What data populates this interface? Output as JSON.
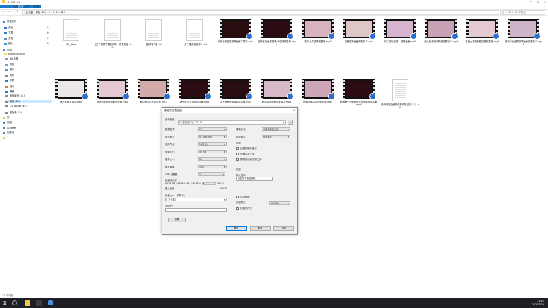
{
  "explorer": {
    "title": "11111111",
    "ribbon_tabs": [
      "文件",
      "主页",
      "共享",
      "查看"
    ],
    "address": "› 此电脑 › 新加 (D:) › 1 › 11111111",
    "search_placeholder": "在 11111111 中搜索",
    "status": "21 个项目"
  },
  "sidebar": {
    "items": [
      {
        "label": "快速访问"
      },
      {
        "label": "桌面"
      },
      {
        "label": "下载"
      },
      {
        "label": "文档"
      },
      {
        "label": "图片"
      },
      {
        "label": "电脑"
      },
      {
        "label": "Administrator"
      },
      {
        "label": "3D 对象"
      },
      {
        "label": "视频"
      },
      {
        "label": "图片"
      },
      {
        "label": "文档"
      },
      {
        "label": "下载"
      },
      {
        "label": "音乐"
      },
      {
        "label": "桌面"
      },
      {
        "label": "本地磁盘 (C:)"
      },
      {
        "label": "新加 (D:)"
      },
      {
        "label": "CD 驱动器 (E:)"
      },
      {
        "label": "新加卷 (F:)"
      },
      {
        "label": "库"
      },
      {
        "label": "网络"
      },
      {
        "label": "控制面板"
      },
      {
        "label": "回收站"
      },
      {
        "label": "1"
      }
    ]
  },
  "files": [
    {
      "name": "DS_Store",
      "kind": "doc"
    },
    {
      "name": "【关于视频下载站说明（请查看）】.txt",
      "kind": "doc"
    },
    {
      "name": "【仅供学习】.txt",
      "kind": "doc"
    },
    {
      "name": "【关于播放器推荐】.txt",
      "kind": "doc"
    },
    {
      "name": "清晰合集超高视频画面下载中.mp4",
      "kind": "video",
      "color": "#2a0d10"
    },
    {
      "name": "全新系列画质超清4K高清完整版.mp4",
      "kind": "video",
      "color": "#2b0c12"
    },
    {
      "name": "新年会员超清完整版.mp4",
      "kind": "video",
      "color": "#d9b2c2"
    },
    {
      "name": "白嫩高清画面完整版本.mp4",
      "kind": "video",
      "color": "#e0c7c7"
    },
    {
      "name": "博主课后拍照，超清画面.mp4",
      "kind": "video",
      "color": "#d6b4d0"
    },
    {
      "name": "美女合集全网精选完整版本.mp4",
      "kind": "video",
      "color": "#c9a1b5"
    },
    {
      "name": "可爱女孩的家居合集完整版.mp4",
      "kind": "video",
      "color": "#e4c9d0"
    },
    {
      "name": "最新少女合集高清画面完整版本.mp4",
      "kind": "video",
      "color": "#cfb3c8"
    },
    {
      "name": "黑丝美腿写真集.mp4",
      "kind": "video",
      "color": "#ece8e8"
    },
    {
      "name": "精品小姐姐系列超清视频.mp4",
      "kind": "video",
      "color": "#e4c8d2"
    },
    {
      "name": "美少女生活写真合集.mp4",
      "kind": "video",
      "color": "#d4a9a9"
    },
    {
      "name": "我的女友日常视频合集.mp4",
      "kind": "video",
      "color": "#2b0c12"
    },
    {
      "name": "本子漫画完整版高清合集.mp4",
      "kind": "video",
      "color": "#2a0d10"
    },
    {
      "name": "精选高清视频合集版本.mp4",
      "kind": "video",
      "color": "#d6b8c8"
    },
    {
      "name": "完整正版高清视频合集.mp4",
      "kind": "video",
      "color": "#cfa5b8"
    },
    {
      "name": "超清第一人称视角完整版本视频合集.mp4",
      "kind": "video",
      "color": "#2b0c12"
    },
    {
      "name": "最新网站及资源合集领取说明（1）.txt",
      "kind": "doc"
    }
  ],
  "dialog": {
    "title": "高级预设置面板",
    "path_label": "目标路径",
    "path_value": "D:\\新加卷(D:)\\1111111",
    "fields_left": [
      {
        "label": "数据格式",
        "value": "72"
      },
      {
        "label": "运行模式",
        "value": "5 - 标准设置"
      },
      {
        "label": "使用节点",
        "value": "1 (默认)"
      },
      {
        "label": "传输大小",
        "value": "32 MB"
      },
      {
        "label": "缓存大小",
        "value": "32"
      },
      {
        "label": "最大线程",
        "value": "1.00"
      },
      {
        "label": "CPU 线程数",
        "value": "2"
      }
    ],
    "memory_label": "已使用内存：",
    "memory_value": "2052 MB / 16016 MB（12.76%）",
    "memory_fill": 0.13,
    "memory_pct": "100%",
    "max_memory_label": "最大内存",
    "max_memory_value": "32 MB",
    "split_label": "分卷大小，字节(V)",
    "split_value": "[ 不分卷 ]",
    "password_label": "密码(P)",
    "settings_button": "设置",
    "fields_right": [
      {
        "label": "更新方式",
        "value": "添加并替换文件"
      },
      {
        "label": "路径模式",
        "value": "相对路径"
      }
    ],
    "options_label": "选项",
    "options": [
      {
        "label": "创建自解压格式",
        "checked": false
      },
      {
        "label": "压缩共享文件",
        "checked": false
      },
      {
        "label": "删除完成后的源文件",
        "checked": false
      }
    ],
    "encrypt_label": "加密",
    "encrypt_input_label": "输入密码",
    "encrypt_value": "点击下方按钮获取",
    "show_password_label": "显示密码",
    "show_password_checked": true,
    "method_label": "加密算法",
    "method_value": "AES-256",
    "encrypt_names_label": "加密文件名",
    "encrypt_names_checked": false,
    "ok": "确定",
    "cancel": "取消",
    "help": "帮助"
  },
  "taskbar": {
    "time": "21:51",
    "date": "2020/7/22"
  }
}
